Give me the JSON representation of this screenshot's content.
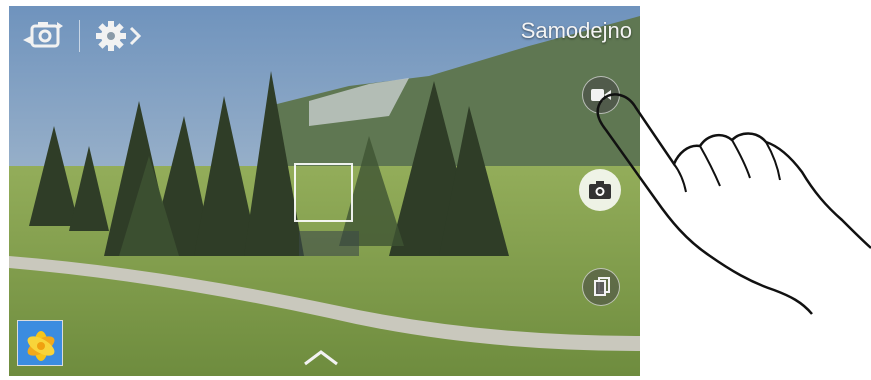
{
  "header": {
    "mode_label": "Samodejno"
  },
  "icons": {
    "switch_camera": "switch-camera-icon",
    "settings": "settings-icon",
    "video": "video-camera-icon",
    "shutter": "camera-icon",
    "mode": "mode-icon",
    "gallery": "gallery-thumbnail",
    "expand": "chevron-up-icon"
  },
  "colors": {
    "overlay_text": "#f4f4f4",
    "shutter_bg": "#ffffff",
    "icon_dark": "#333333"
  }
}
